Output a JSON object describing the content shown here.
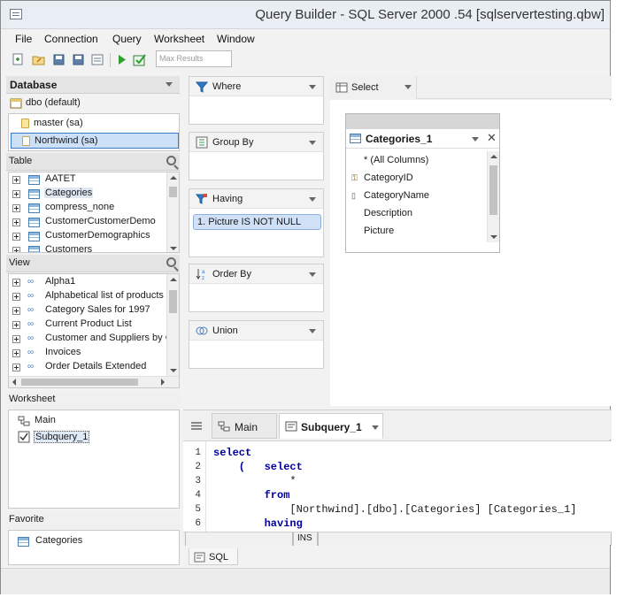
{
  "window": {
    "title": "Query Builder - SQL Server 2000 .54 [sqlservertesting.qbw]"
  },
  "menu": [
    "File",
    "Connection",
    "Query",
    "Worksheet",
    "Window"
  ],
  "toolbar": {
    "max_results_placeholder": "Max Results"
  },
  "database": {
    "header": "Database",
    "default": "dbo (default)",
    "items": [
      {
        "label": "master (sa)"
      },
      {
        "label": "Northwind (sa)"
      }
    ]
  },
  "tables": {
    "header": "Table",
    "items": [
      "AATET",
      "Categories",
      "compress_none",
      "CustomerCustomerDemo",
      "CustomerDemographics",
      "Customers"
    ]
  },
  "views": {
    "header": "View",
    "items": [
      "Alpha1",
      "Alphabetical list of products",
      "Category Sales for 1997",
      "Current Product List",
      "Customer and Suppliers by C",
      "Invoices",
      "Order Details Extended"
    ]
  },
  "worksheet": {
    "header": "Worksheet",
    "items": [
      "Main",
      "Subquery_1"
    ]
  },
  "favorite": {
    "header": "Favorite",
    "items": [
      "Categories"
    ]
  },
  "clauses": {
    "where": "Where",
    "group_by": "Group By",
    "having": "Having",
    "having_item": "1. Picture IS NOT NULL",
    "order_by": "Order By",
    "union": "Union"
  },
  "design": {
    "select_tab": "Select",
    "table_card": {
      "title": "Categories_1",
      "columns": [
        "* (All Columns)",
        "CategoryID",
        "CategoryName",
        "Description",
        "Picture"
      ]
    }
  },
  "editor": {
    "tabs": [
      "Main",
      "Subquery_1"
    ],
    "lines": [
      {
        "n": "1",
        "text": "select"
      },
      {
        "n": "2",
        "text": "    (   select"
      },
      {
        "n": "3",
        "text": "            *"
      },
      {
        "n": "4",
        "text": "        from"
      },
      {
        "n": "5",
        "text": "            [Northwind].[dbo].[Categories] [Categories_1]"
      },
      {
        "n": "6",
        "text": "        having"
      }
    ],
    "status_mode": "INS",
    "bottom_tab": "SQL"
  }
}
